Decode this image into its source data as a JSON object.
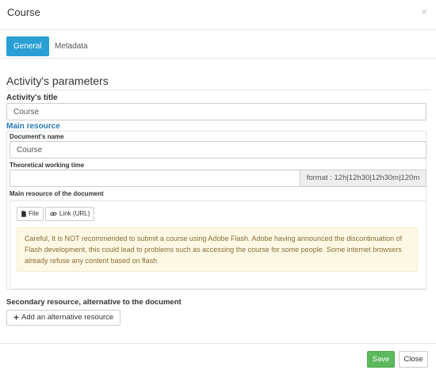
{
  "modal": {
    "title": "Course",
    "close_glyph": "×"
  },
  "tabs": [
    {
      "label": "General",
      "active": true
    },
    {
      "label": "Metadata",
      "active": false
    }
  ],
  "section": {
    "title": "Activity's parameters"
  },
  "activity_title": {
    "label": "Activity's title",
    "value": "Course"
  },
  "main_resource": {
    "heading": "Main resource",
    "document_name_label": "Document's name",
    "document_name_value": "Course",
    "working_time_label": "Theoretical working time",
    "working_time_value": "",
    "working_time_format": "format : 12h|12h30|12h30m|120m",
    "document_label": "Main resource of the document",
    "file_button": "File",
    "link_button": "Link (URL)",
    "warning": "Careful, It is NOT recommended to submit a course using Adobe Flash. Adobe having announced the discontinuation of Flash development, this could lead to problems such as accessing the course for some people. Some internet browsers already refuse any content based on flash"
  },
  "secondary": {
    "label": "Secondary resource, alternative to the document",
    "add_button": "Add an alternative resource"
  },
  "footer": {
    "save_label": "Save",
    "close_label": "Close"
  },
  "icons": {
    "file": "file-icon",
    "link": "link-icon",
    "plus": "plus-icon",
    "close": "close-icon"
  },
  "colors": {
    "primary": "#2a9fd6",
    "success": "#5cb85c",
    "link": "#2a7ab8",
    "warning_bg": "#fcf8e3",
    "warning_text": "#8a6d3b"
  }
}
